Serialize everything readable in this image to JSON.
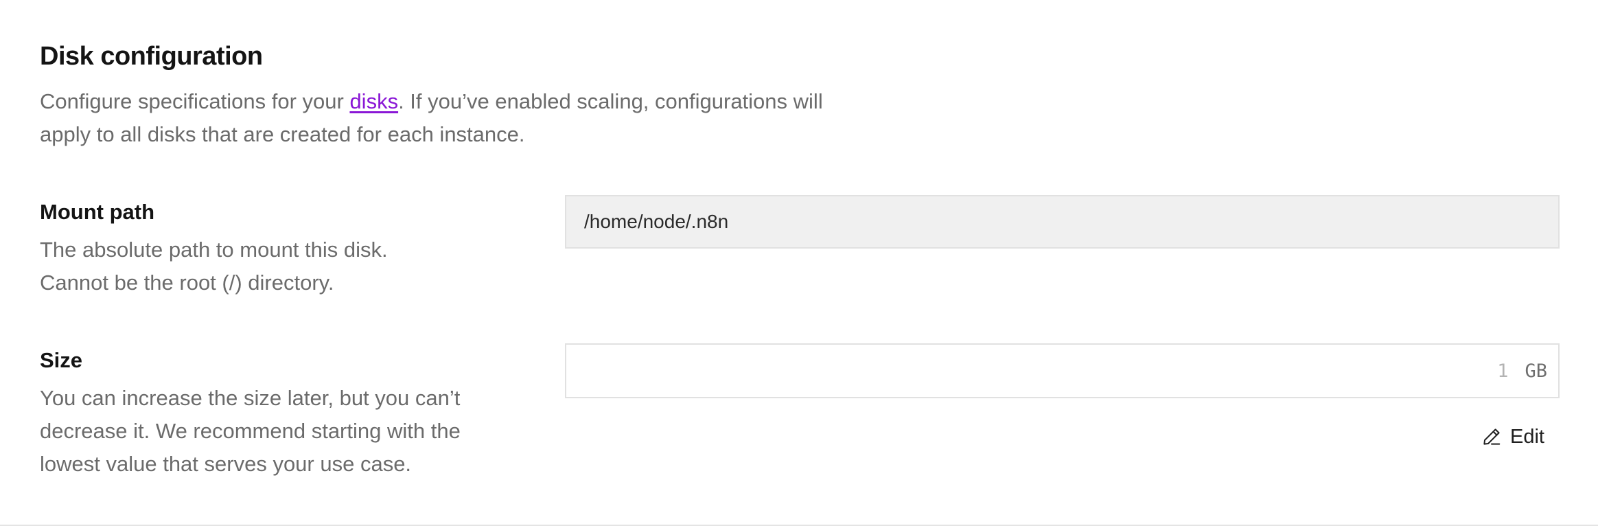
{
  "section": {
    "title": "Disk configuration",
    "description_before_link": "Configure specifications for your ",
    "description_link": "disks",
    "description_after_link": ". If you’ve enabled scaling, configurations will apply to all disks that are created for each instance."
  },
  "mount_path": {
    "label": "Mount path",
    "help_line1": "The absolute path to mount this disk.",
    "help_line2": "Cannot be the root (/) directory.",
    "value": "/home/node/.n8n"
  },
  "size": {
    "label": "Size",
    "help": "You can increase the size later, but you can’t decrease it. We recommend starting with the lowest value that serves your use case.",
    "value": "1",
    "unit": "GB",
    "edit_label": "Edit",
    "edit_icon": "pencil-icon"
  }
}
